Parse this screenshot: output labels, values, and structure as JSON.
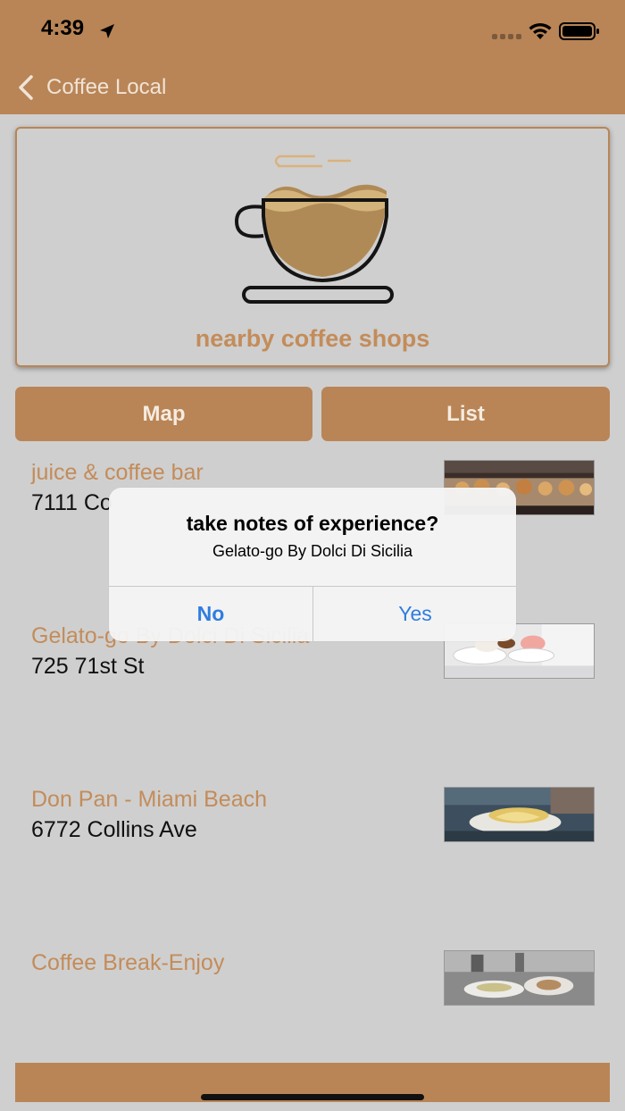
{
  "status_bar": {
    "time": "4:39"
  },
  "nav": {
    "back_label": "Coffee Local"
  },
  "hero": {
    "label": "nearby coffee shops"
  },
  "segments": {
    "map_label": "Map",
    "list_label": "List"
  },
  "shops": [
    {
      "name": "juice & coffee bar",
      "address": "7111 Co"
    },
    {
      "name": "Gelato-go By Dolci Di Sicilia",
      "address": "725 71st St"
    },
    {
      "name": "Don Pan - Miami Beach",
      "address": "6772 Collins Ave"
    },
    {
      "name": "Coffee Break-Enjoy",
      "address": ""
    }
  ],
  "alert": {
    "title": "take notes of experience?",
    "message": "Gelato-go By Dolci Di Sicilia",
    "no_label": "No",
    "yes_label": "Yes"
  },
  "colors": {
    "brand": "#b98556",
    "accent_text": "#c38c5a",
    "background": "#cfcfcf",
    "alert_button": "#2f7de0"
  }
}
